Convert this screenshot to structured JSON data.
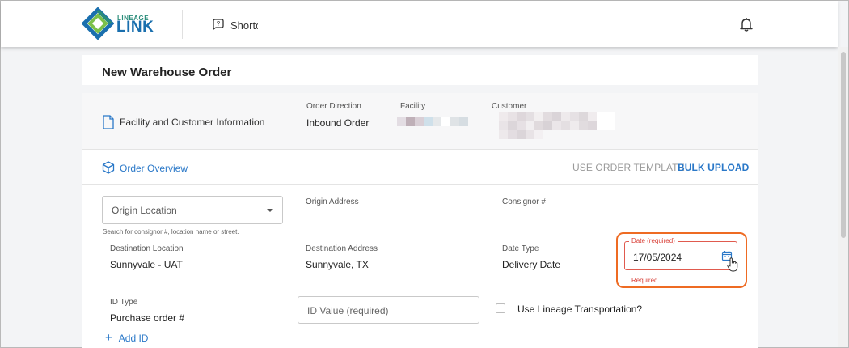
{
  "header": {
    "logo_top": "LINEAGE",
    "logo_bottom": "LINK",
    "shortcut_label": "Shortcu",
    "bell_icon": "bell-icon"
  },
  "page": {
    "title": "New Warehouse Order"
  },
  "facility_section": {
    "label": "Facility and Customer Information",
    "order_direction_label": "Order Direction",
    "order_direction_value": "Inbound Order",
    "facility_label": "Facility",
    "customer_label": "Customer"
  },
  "overview": {
    "label": "Order Overview",
    "use_template": "USE ORDER TEMPLATE",
    "bulk_upload": "BULK UPLOAD"
  },
  "form": {
    "origin_location_placeholder": "Origin Location",
    "origin_helper": "Search for consignor #, location name or street.",
    "origin_address_label": "Origin Address",
    "consignor_label": "Consignor #",
    "destination_location_label": "Destination Location",
    "destination_location_value": "Sunnyvale - UAT",
    "destination_address_label": "Destination Address",
    "destination_address_value": "Sunnyvale, TX",
    "date_type_label": "Date Type",
    "date_type_value": "Delivery Date",
    "date_label": "Date (required)",
    "date_value": "17/05/2024",
    "date_error": "Required",
    "id_type_label": "ID Type",
    "id_type_value": "Purchase order #",
    "id_value_placeholder": "ID Value (required)",
    "lineage_transport_label": "Use Lineage Transportation?",
    "add_id_label": "Add ID"
  },
  "colors": {
    "accent_blue": "#2a78c8",
    "error_red": "#d9423a",
    "highlight_orange": "#ee6b23"
  }
}
